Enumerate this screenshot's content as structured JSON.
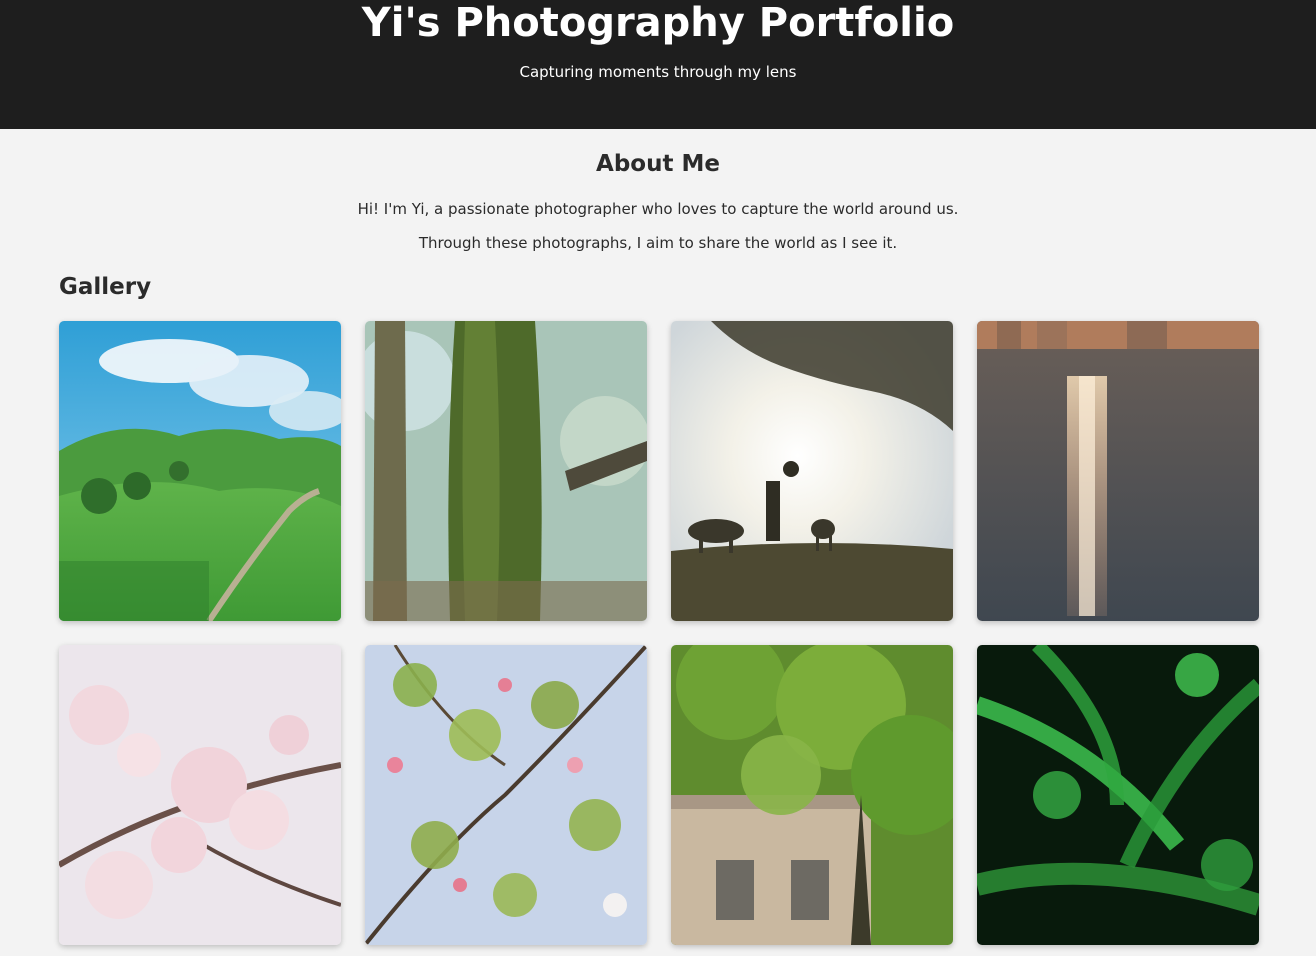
{
  "header": {
    "title": "Yi's Photography Portfolio",
    "subtitle": "Capturing moments through my lens"
  },
  "about": {
    "heading": "About Me",
    "paragraphs": [
      "Hi! I'm Yi, a passionate photographer who loves to capture the world around us.",
      "Through these photographs, I aim to share the world as I see it."
    ]
  },
  "gallery": {
    "heading": "Gallery",
    "photos": [
      {
        "subject": "green hills under blue sky"
      },
      {
        "subject": "mossy tree trunk"
      },
      {
        "subject": "silhouette feeding deer at sunset"
      },
      {
        "subject": "sunlight reflecting on water"
      },
      {
        "subject": "pink cherry blossoms"
      },
      {
        "subject": "blossoming branches against sky"
      },
      {
        "subject": "trees in front of building"
      },
      {
        "subject": "dark green fern leaves"
      }
    ]
  },
  "colors": {
    "header_bg": "#1e1e1e",
    "page_bg": "#f3f3f3",
    "text": "#2b2b2b"
  }
}
